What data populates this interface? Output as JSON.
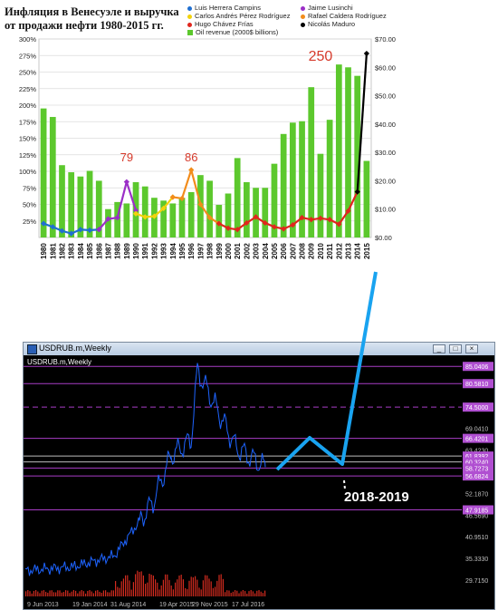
{
  "top_chart": {
    "title": "Инфляция в Венесуэле и выручка от продажи нефти 1980-2015 гг.",
    "legend": [
      {
        "label": "Luis Herrera Campins",
        "color": "#1f6fd1",
        "shape": "dot"
      },
      {
        "label": "Jaime Lusinchi",
        "color": "#9b2fc7",
        "shape": "dot"
      },
      {
        "label": "Carlos Andrés Pérez Rodríguez",
        "color": "#f2d20c",
        "shape": "dot"
      },
      {
        "label": "Rafael Caldera Rodríguez",
        "color": "#f28c1b",
        "shape": "dot"
      },
      {
        "label": "Hugo Chávez Frías",
        "color": "#e0261d",
        "shape": "dot"
      },
      {
        "label": "Nicolás Maduro",
        "color": "#000000",
        "shape": "dot"
      },
      {
        "label": "Oil revenue (2000$ billions)",
        "color": "#5cc82d",
        "shape": "square"
      }
    ],
    "annotations": [
      {
        "text": "79",
        "year": 1989,
        "value": 0.79,
        "color": "#d63a2b"
      },
      {
        "text": "86",
        "year": 1996,
        "value": 0.86,
        "color": "#d63a2b"
      },
      {
        "text": "250",
        "year": 2010,
        "value": 2.5,
        "color": "#d63a2b"
      }
    ]
  },
  "chart_data": [
    {
      "type": "bar",
      "title": "Инфляция в Венесуэле и выручка от продажи нефти 1980-2015 гг.",
      "categories": [
        "1980",
        "1981",
        "1982",
        "1983",
        "1984",
        "1985",
        "1986",
        "1987",
        "1988",
        "1989",
        "1990",
        "1991",
        "1992",
        "1993",
        "1994",
        "1995",
        "1996",
        "1997",
        "1998",
        "1999",
        "2000",
        "2001",
        "2002",
        "2003",
        "2004",
        "2005",
        "2006",
        "2007",
        "2008",
        "2009",
        "2010",
        "2011",
        "2012",
        "2013",
        "2014",
        "2015"
      ],
      "left_axis": {
        "ticks": [
          "25%",
          "50%",
          "75%",
          "100%",
          "125%",
          "150%",
          "175%",
          "200%",
          "225%",
          "250%",
          "275%",
          "300%"
        ],
        "ylim": [
          0,
          3.0
        ]
      },
      "right_axis": {
        "ticks": [
          "$0.00",
          "$10.00",
          "$20.00",
          "$30.00",
          "$40.00",
          "$50.00",
          "$60.00",
          "$70.00"
        ],
        "ylim": [
          0,
          70
        ]
      },
      "series": [
        {
          "name": "Oil revenue (2000$ billions)",
          "axis": "right",
          "kind": "bar",
          "color": "#5cc82d",
          "values": [
            45.5,
            42.5,
            25.5,
            23,
            21.5,
            23.5,
            20,
            10,
            12.5,
            12,
            19.5,
            18,
            14,
            13,
            12,
            14,
            16,
            22,
            20,
            11.5,
            15.5,
            28,
            19.5,
            17.5,
            17.5,
            26,
            36.5,
            40.5,
            41,
            53,
            29.5,
            41.5,
            61,
            60,
            57,
            27,
            9
          ]
        },
        {
          "name": "Luis Herrera Campins",
          "axis": "left",
          "kind": "line",
          "color": "#1f6fd1",
          "x": [
            "1980",
            "1981",
            "1982",
            "1983",
            "1984",
            "1985",
            "1986"
          ],
          "values": [
            0.21,
            0.16,
            0.1,
            0.06,
            0.12,
            0.11,
            0.12
          ]
        },
        {
          "name": "Jaime Lusinchi",
          "axis": "left",
          "kind": "line",
          "color": "#9b2fc7",
          "x": [
            "1986",
            "1987",
            "1988",
            "1989",
            "1990"
          ],
          "values": [
            0.12,
            0.28,
            0.3,
            0.84,
            0.41
          ]
        },
        {
          "name": "Carlos Andrés Pérez Rodríguez",
          "axis": "left",
          "kind": "line",
          "color": "#f2d20c",
          "x": [
            "1990",
            "1991",
            "1992",
            "1993",
            "1994"
          ],
          "values": [
            0.36,
            0.31,
            0.32,
            0.44,
            0.61
          ]
        },
        {
          "name": "Rafael Caldera Rodríguez",
          "axis": "left",
          "kind": "line",
          "color": "#f28c1b",
          "x": [
            "1994",
            "1995",
            "1996",
            "1997",
            "1998",
            "1999"
          ],
          "values": [
            0.61,
            0.59,
            1.02,
            0.5,
            0.3,
            0.21
          ]
        },
        {
          "name": "Hugo Chávez Frías",
          "axis": "left",
          "kind": "line",
          "color": "#e0261d",
          "x": [
            "1999",
            "2000",
            "2001",
            "2002",
            "2003",
            "2004",
            "2005",
            "2006",
            "2007",
            "2008",
            "2009",
            "2010",
            "2011",
            "2012",
            "2013",
            "2014"
          ],
          "values": [
            0.21,
            0.14,
            0.12,
            0.22,
            0.31,
            0.22,
            0.16,
            0.13,
            0.19,
            0.3,
            0.27,
            0.29,
            0.27,
            0.2,
            0.4,
            0.69
          ]
        },
        {
          "name": "Nicolás Maduro",
          "axis": "left",
          "kind": "line",
          "color": "#000000",
          "x": [
            "2014",
            "2015"
          ],
          "values": [
            0.69,
            2.78
          ]
        }
      ]
    },
    {
      "type": "line",
      "title": "USDRUB.m,Weekly",
      "x_ticks": [
        "9 Jun 2013",
        "19 Jan 2014",
        "31 Aug 2014",
        "19 Apr 2015",
        "29 Nov 2015",
        "17 Jul 2016"
      ],
      "y_ticks": [
        "29.7150",
        "35.3330",
        "40.9510",
        "46.5690",
        "52.1870",
        "57.8050",
        "63.4230",
        "69.0410",
        "74.5000",
        "80.5810",
        "85.0406"
      ],
      "price_labels": [
        "85.0406",
        "80.5810",
        "74.5000",
        "66.4201",
        "61.8392",
        "60.3240",
        "58.7273",
        "56.6824",
        "47.9185"
      ],
      "ylim": [
        27.4,
        86.5
      ],
      "series": [
        {
          "name": "USDRUB.m",
          "color": "#1e64ff",
          "x": [
            "9 Jun 2013",
            "19 Jan 2014",
            "31 Aug 2014",
            "1 Dec 2014",
            "19 Apr 2015",
            "1 Aug 2015",
            "29 Nov 2015",
            "20 Jan 2016",
            "17 Jul 2016",
            "15 Nov 2016"
          ],
          "values": [
            32.2,
            33.2,
            36.0,
            45.0,
            50.0,
            62.0,
            66.0,
            84.0,
            64.0,
            59.0
          ]
        }
      ],
      "annotations": [
        {
          "text": "2018-2019"
        }
      ]
    }
  ],
  "mt_window": {
    "title": "USDRUB.m,Weekly",
    "chart_label": "USDRUB.m,Weekly",
    "buttons": [
      "_",
      "□",
      "×"
    ]
  }
}
